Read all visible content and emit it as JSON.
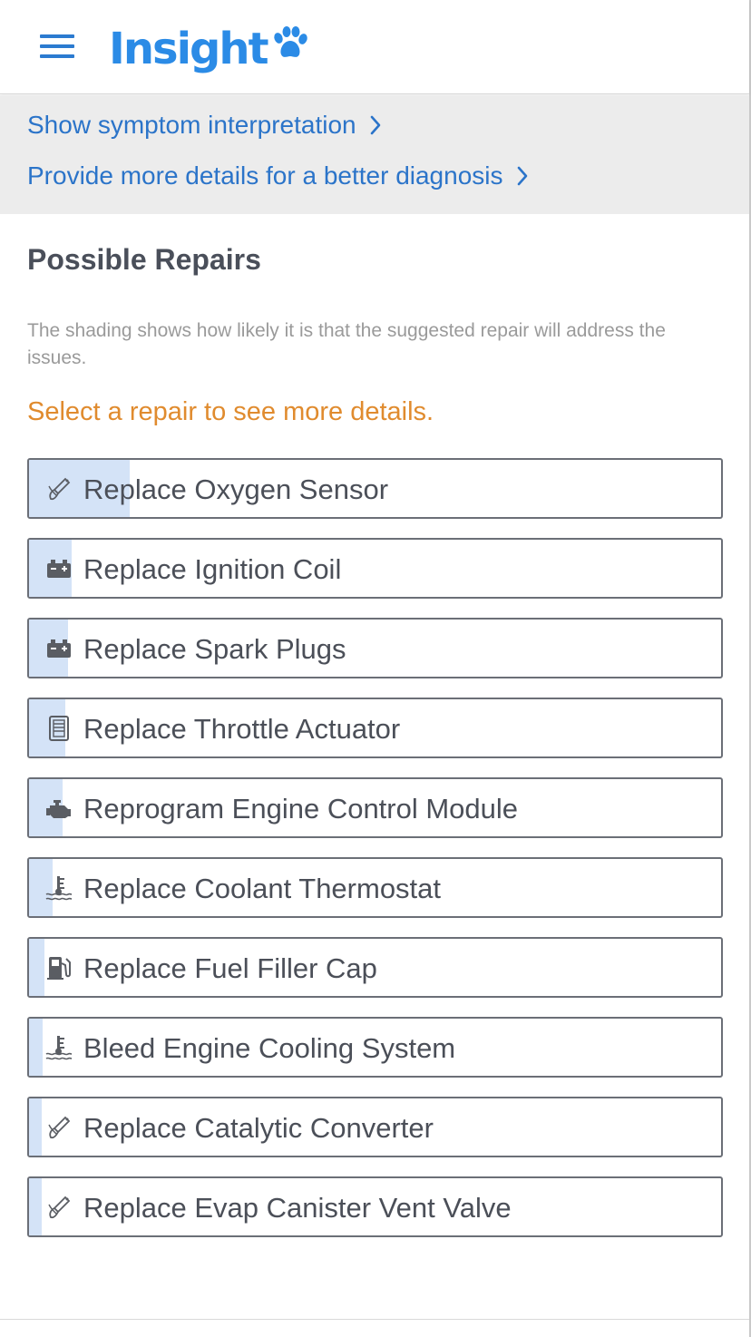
{
  "header": {
    "logo_text": "Insight",
    "brand_color": "#2b8be6",
    "menu_icon": "hamburger-menu-icon",
    "logo_icon": "paw-icon"
  },
  "info_bar": {
    "symptom_link": "Show symptom interpretation",
    "details_link": "Provide more details for a better diagnosis",
    "link_color": "#2b74c9"
  },
  "main": {
    "title": "Possible Repairs",
    "shading_note": "The shading shows how likely it is that the suggested repair will address the issues.",
    "select_prompt": "Select a repair to see more details.",
    "prompt_color": "#e08b2e",
    "shade_color": "#d4e3f7"
  },
  "repairs": [
    {
      "label": "Replace Oxygen Sensor",
      "icon": "oxygen-sensor-icon",
      "likelihood": 0.146
    },
    {
      "label": "Replace Ignition Coil",
      "icon": "battery-icon",
      "likelihood": 0.061
    },
    {
      "label": "Replace Spark Plugs",
      "icon": "battery-icon",
      "likelihood": 0.056
    },
    {
      "label": "Replace Throttle Actuator",
      "icon": "throttle-body-icon",
      "likelihood": 0.053
    },
    {
      "label": "Reprogram Engine Control Module",
      "icon": "engine-icon",
      "likelihood": 0.048
    },
    {
      "label": "Replace Coolant Thermostat",
      "icon": "coolant-temperature-icon",
      "likelihood": 0.034
    },
    {
      "label": "Replace Fuel Filler Cap",
      "icon": "fuel-pump-icon",
      "likelihood": 0.022
    },
    {
      "label": "Bleed Engine Cooling System",
      "icon": "coolant-temperature-icon",
      "likelihood": 0.02
    },
    {
      "label": "Replace Catalytic Converter",
      "icon": "oxygen-sensor-icon",
      "likelihood": 0.019
    },
    {
      "label": "Replace Evap Canister Vent Valve",
      "icon": "oxygen-sensor-icon",
      "likelihood": 0.018
    }
  ]
}
